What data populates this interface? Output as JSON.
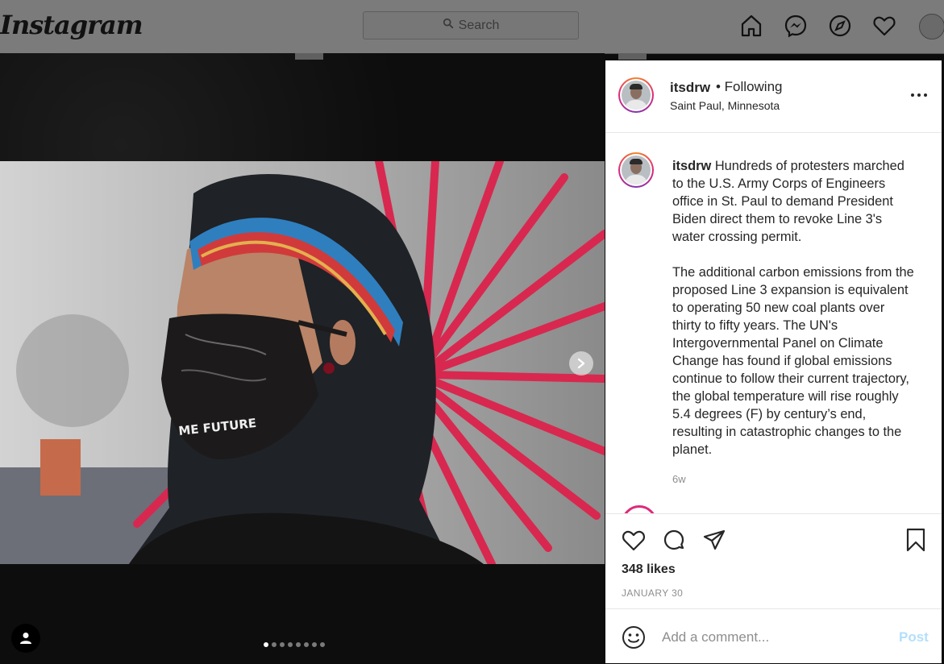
{
  "app": {
    "logo": "Instagram"
  },
  "search": {
    "placeholder": "Search"
  },
  "nav": {
    "icons": [
      "home-icon",
      "messenger-icon",
      "explore-icon",
      "activity-heart-icon",
      "profile-avatar"
    ]
  },
  "post": {
    "username": "itsdrw",
    "follow_status": "• Following",
    "location": "Saint Paul, Minnesota",
    "caption_username": "itsdrw",
    "caption": " Hundreds of protesters marched to the U.S. Army Corps of Engineers office in St. Paul to demand President Biden direct them to revoke Line 3's water crossing permit.\n\nThe additional carbon emissions from the proposed Line 3 expansion is equivalent to operating 50 new coal plants over thirty to fifty years. The UN's Intergovernmental Panel on Climate Change has found if global emissions continue to follow their current trajectory, the global temperature will rise roughly 5.4 degrees (F) by century’s end, resulting in catastrophic changes to the planet.",
    "time_ago": "6w",
    "likes": "348 likes",
    "date": "JANUARY 30",
    "mask_text": "ME FUTURE"
  },
  "carousel": {
    "slide_count": 8,
    "active_index": 0
  },
  "comment": {
    "placeholder": "Add a comment...",
    "post_label": "Post"
  },
  "colors": {
    "accent": "#b2dffc",
    "ring": "#dd2a7b",
    "feathers": "#d8284f"
  }
}
